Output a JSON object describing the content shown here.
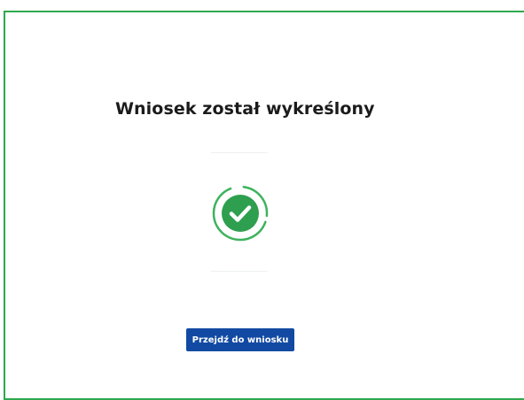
{
  "dialog": {
    "title": "Wniosek został wykreślony",
    "status_icon": "check-circle-icon",
    "primary_button_label": "Przejdź do wniosku"
  },
  "colors": {
    "frame_border": "#2ea84f",
    "success": "#2e9f4e",
    "success_ring": "#3cb35c",
    "button": "#124aa3",
    "button_text": "#ffffff",
    "title": "#1b1b1b"
  }
}
